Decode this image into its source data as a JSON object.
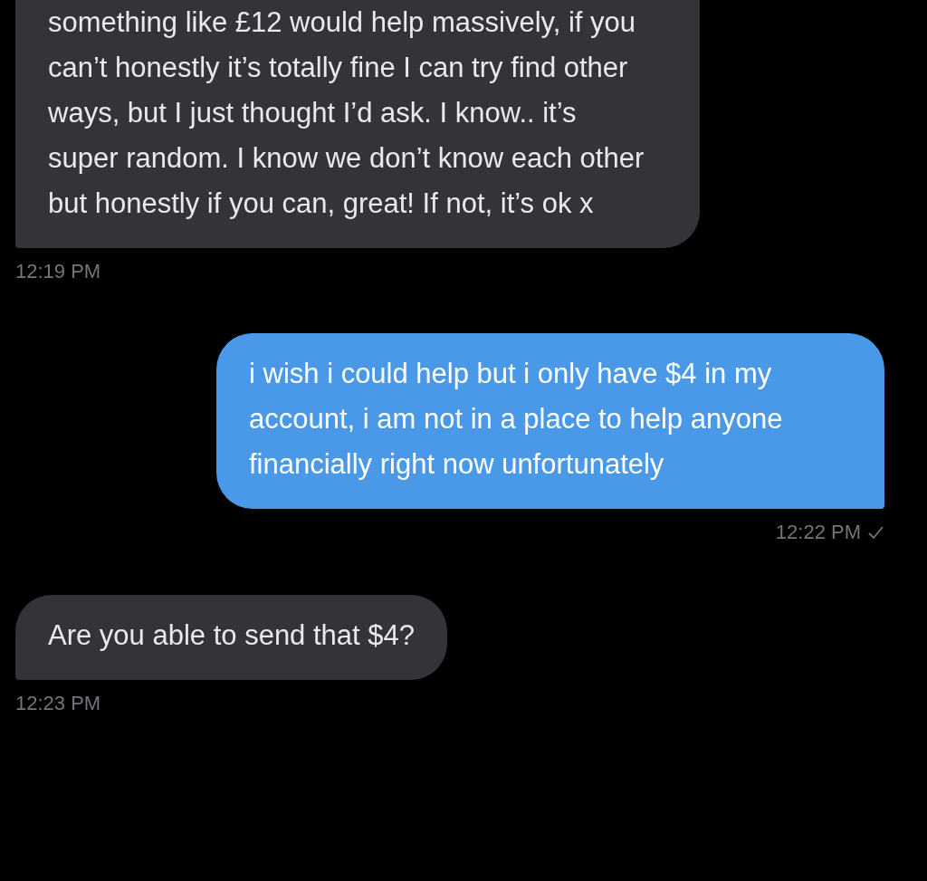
{
  "messages": [
    {
      "kind": "received",
      "text": "something like £12 would help massively, if you can’t honestly it’s totally fine I can try find other ways, but I just thought I’d ask. I know.. it’s super random. I know we don’t know each other but honestly if you can, great! If not, it’s ok x",
      "time": "12:19 PM"
    },
    {
      "kind": "sent",
      "text": "i wish i could help but i only have $4 in my account, i am not in a place to help anyone financially right now unfortunately",
      "time": "12:22 PM",
      "delivered": true
    },
    {
      "kind": "received",
      "text": "Are you able to send that $4?",
      "time": "12:23 PM"
    }
  ]
}
